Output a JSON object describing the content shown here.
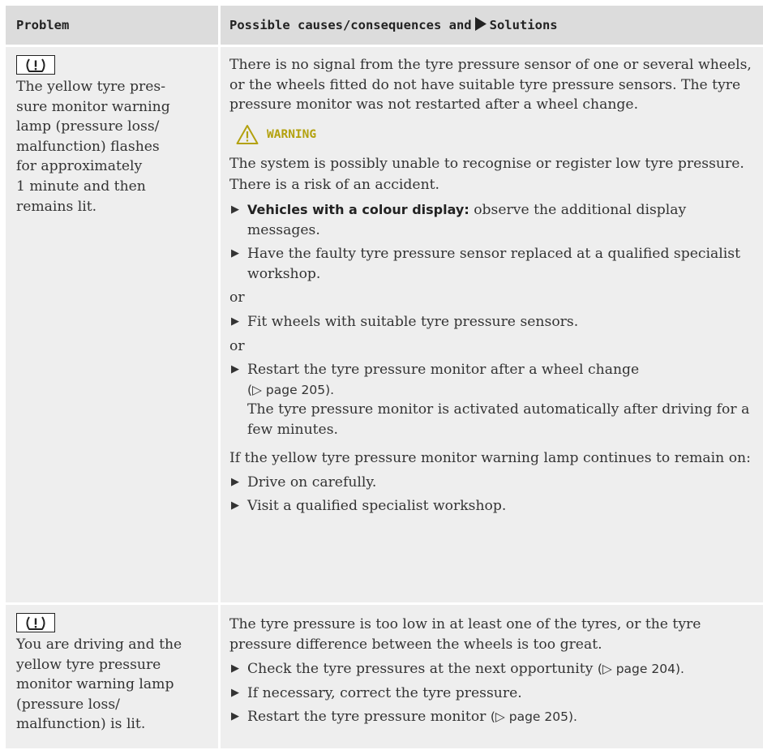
{
  "table": {
    "headers": {
      "problem": "Problem",
      "solution_prefix": "Possible causes/consequences and",
      "solution_suffix": "Solutions"
    },
    "rows": [
      {
        "icon": "tyre-pressure-warning-icon",
        "problem": "The yellow tyre pres-\nsure monitor warning\nlamp (pressure loss/\nmalfunction) flashes\nfor approximately\n1 minute and then\nremains lit.",
        "intro": "There is no signal from the tyre pressure sensor of one or several wheels, or the wheels fitted do not have suitable tyre pressure sensors. The tyre pressure monitor was not restarted after a wheel change.",
        "warning_label": "WARNING",
        "warning_lines": [
          "The system is possibly unable to recognise or register low tyre pressure.",
          "There is a risk of an accident."
        ],
        "step1_bold": "Vehicles with a colour display:",
        "step1_text": " observe the additional display messages.",
        "step2": "Have the faulty tyre pressure sensor replaced at a qualified specialist workshop.",
        "or1": "or",
        "step3": "Fit wheels with suitable tyre pressure sensors.",
        "or2": "or",
        "step4": "Restart the tyre pressure monitor after a wheel change",
        "step4_ref": "(▷ page 205).",
        "step4_note": "The tyre pressure monitor is activated automatically after driving for a few minutes.",
        "continue_text": "If the yellow tyre pressure monitor warning lamp continues to remain on:",
        "step5": "Drive on carefully.",
        "step6": "Visit a qualified specialist workshop."
      },
      {
        "icon": "tyre-pressure-warning-icon",
        "problem": "You are driving and the\nyellow tyre pressure\nmonitor warning lamp\n(pressure loss/\nmalfunction) is lit.",
        "intro": "The tyre pressure is too low in at least one of the tyres, or the tyre pressure difference between the wheels is too great.",
        "step1": "Check the tyre pressures at the next opportunity",
        "step1_ref": "(▷ page 204).",
        "step2": "If necessary, correct the tyre pressure.",
        "step3": "Restart the tyre pressure monitor",
        "step3_ref": "(▷ page 205)."
      }
    ]
  },
  "colors": {
    "header_bg": "#dcdcdc",
    "row_bg": "#eeeeee",
    "warning": "#b3a10e"
  }
}
